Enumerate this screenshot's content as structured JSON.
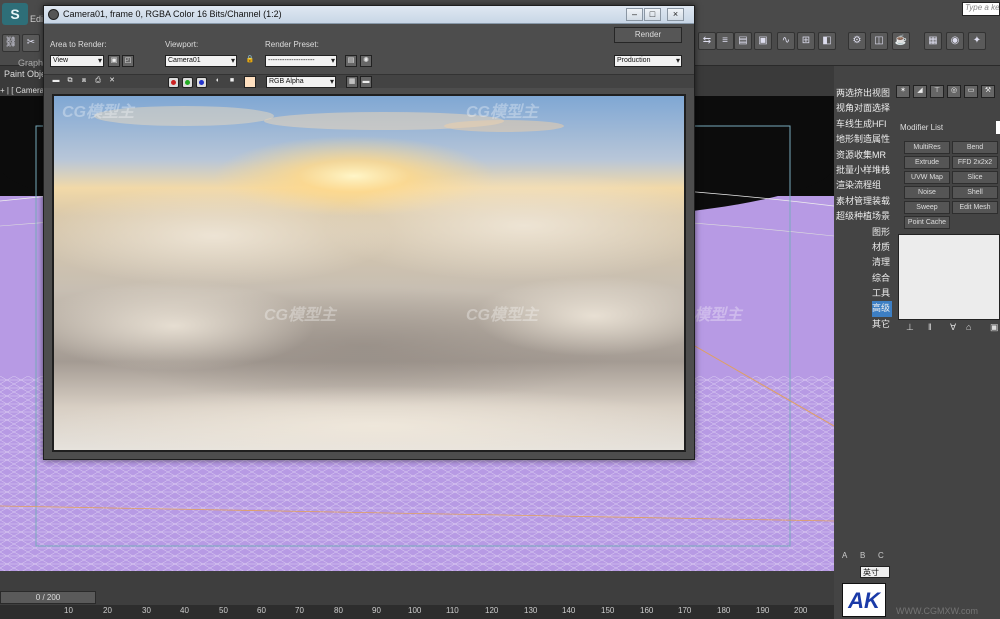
{
  "app": {
    "logo_text": "S",
    "menu_edit": "Edi",
    "graph_tab": "Graph",
    "paint_tab": "Paint Obje",
    "viewport_label": "+ | [ Camera0",
    "search_placeholder": "Type a ke"
  },
  "render_window": {
    "title": "Camera01, frame 0, RGBA Color 16 Bits/Channel (1:2)",
    "minimize": "–",
    "restore": "□",
    "close": "×",
    "area_to_render_label": "Area to Render:",
    "area_to_render_value": "View",
    "viewport_label": "Viewport:",
    "viewport_value": "Camera01",
    "render_preset_label": "Render Preset:",
    "render_preset_value": "--------------------",
    "render_button": "Render",
    "render_mode_value": "Production",
    "channel_value": "RGB Alpha",
    "colors": {
      "red": "#cc2222",
      "green": "#22aa22",
      "blue": "#2233cc",
      "swatch": "#ffe0c0"
    }
  },
  "command_panel": {
    "items_col1": [
      "两选挤出",
      "视角对面",
      "车线生成",
      "地形制造",
      "资源收集",
      "批量小样",
      "渲染流程",
      "素材管理",
      "超级种植"
    ],
    "items_col2": [
      "视图",
      "选择",
      "HFI",
      "属性",
      "MR",
      "堆栈",
      "组",
      "装载",
      "场景",
      "图形",
      "材质",
      "清理",
      "综合",
      "工具",
      "高级",
      "其它"
    ],
    "selected_item": "高级",
    "modifier_list_label": "Modifier List",
    "modifiers": [
      "MultiRes",
      "Bend",
      "Extrude",
      "FFD 2x2x2",
      "UVW Map",
      "Slice",
      "Noise",
      "Shell",
      "Sweep",
      "Edit Mesh",
      "Point Cache"
    ],
    "abc_labels": [
      "A",
      "B",
      "C"
    ],
    "units_value": "英寸"
  },
  "timeline": {
    "frame_counter": "0 / 200",
    "ticks": [
      "10",
      "20",
      "30",
      "40",
      "50",
      "60",
      "70",
      "80",
      "90",
      "100",
      "110",
      "120",
      "130",
      "140",
      "150",
      "160",
      "170",
      "180",
      "190",
      "200"
    ]
  },
  "watermark": {
    "brand": "CG模型主",
    "url": "WWW.CGMXW.com"
  },
  "logo_ak": "AK"
}
